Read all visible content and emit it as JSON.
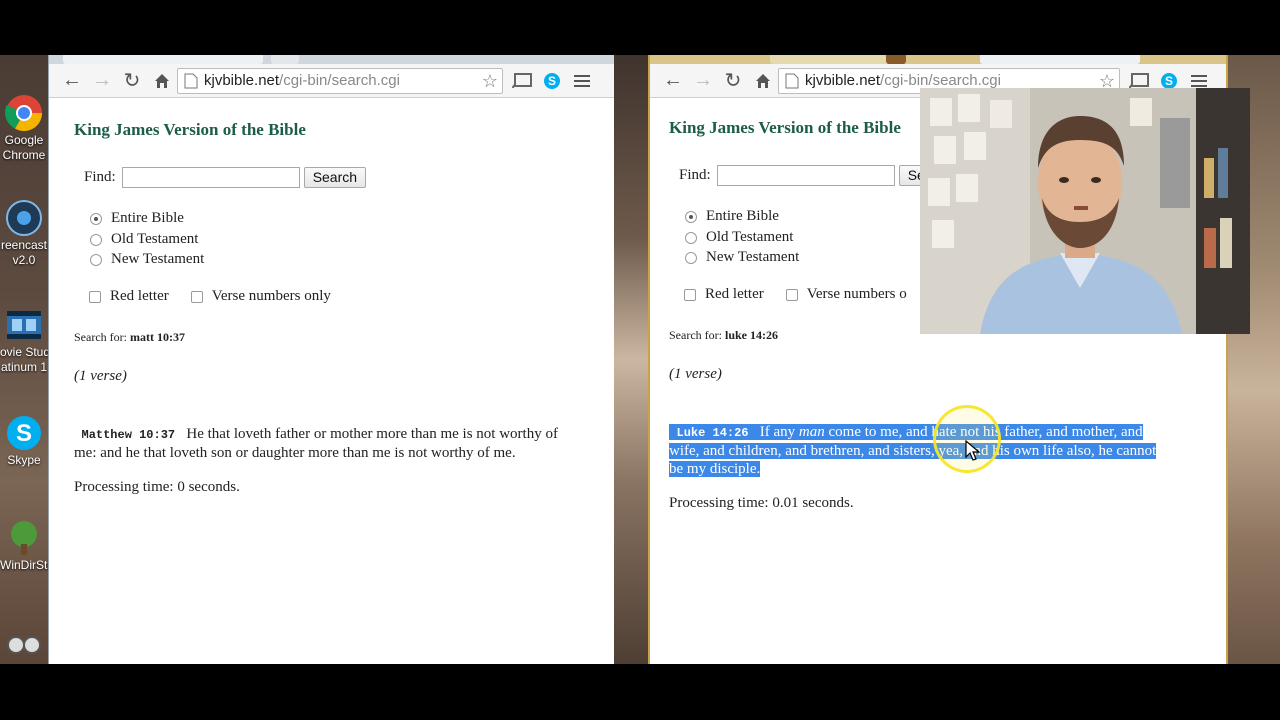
{
  "desktop": {
    "icons": [
      {
        "name": "google-chrome",
        "label1": "Google",
        "label2": "Chrome"
      },
      {
        "name": "screencast",
        "label1": "reencast",
        "label2": "v2.0"
      },
      {
        "name": "movie-studio",
        "label1": "ovie Stud",
        "label2": "atinum 1"
      },
      {
        "name": "skype",
        "label1": "Skype",
        "label2": ""
      },
      {
        "name": "windirstat",
        "label1": "WinDirSta",
        "label2": ""
      }
    ]
  },
  "left_browser": {
    "url_domain": "kjvbible.net",
    "url_path": "/cgi-bin/search.cgi",
    "page": {
      "title": "King James Version of the Bible",
      "find_label": "Find:",
      "find_value": "",
      "search_button": "Search",
      "scopes": [
        "Entire Bible",
        "Old Testament",
        "New Testament"
      ],
      "selected_scope": "Entire Bible",
      "red_letter_label": "Red letter",
      "verse_numbers_label": "Verse numbers only",
      "search_for_label": "Search for:",
      "search_for_value": "matt 10:37",
      "result_count": "(1 verse)",
      "verse_ref": "Matthew 10:37",
      "verse_text_line1": "He that loveth father or mother more than me is not worthy of",
      "verse_text_line2": "me: and he that loveth son or daughter more than me is not worthy of me.",
      "processing_time": "Processing time: 0 seconds."
    }
  },
  "right_browser": {
    "url_domain": "kjvbible.net",
    "url_path": "/cgi-bin/search.cgi",
    "page": {
      "title": "King James Version of the Bible",
      "find_label": "Find:",
      "find_value": "",
      "search_button_visible": "Se",
      "scopes": [
        "Entire Bible",
        "Old Testament",
        "New Testament"
      ],
      "selected_scope": "Entire Bible",
      "red_letter_label": "Red letter",
      "verse_numbers_label": "Verse numbers o",
      "search_for_label": "Search for:",
      "search_for_value": "luke 14:26",
      "result_count": "(1 verse)",
      "verse_ref": "Luke 14:26",
      "verse_line1_pre": "If any ",
      "verse_line1_em": "man",
      "verse_line1_post": " come to me, and hate not his father, and mother, and",
      "verse_line2": "wife, and children, and brethren, and sisters, yea, and his own life also, he cannot",
      "verse_line3": "be my disciple.",
      "processing_time": "Processing time: 0.01 seconds."
    }
  },
  "colors": {
    "title_green": "#1d5b4a",
    "selection_blue": "#3b88e8",
    "cursor_ring_yellow": "#f5e628"
  }
}
